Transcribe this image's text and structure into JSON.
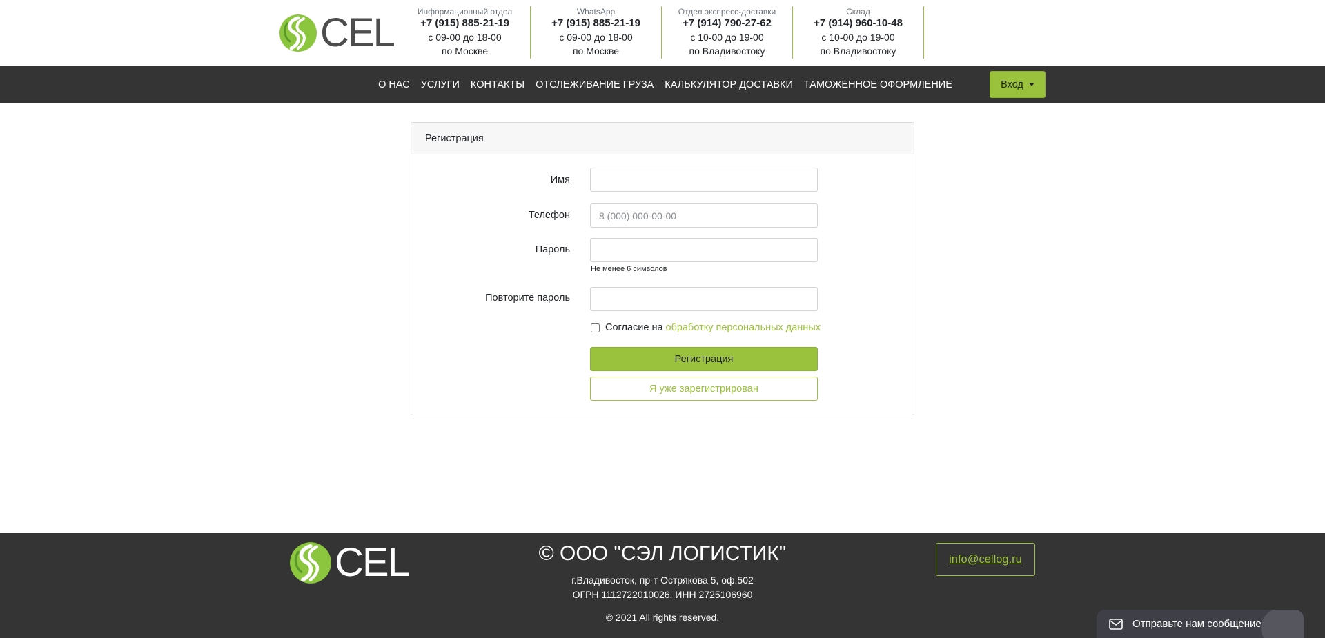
{
  "header": {
    "logo_text": "CEL",
    "contacts": [
      {
        "label": "Информационный отдел",
        "phone": "+7 (915) 885-21-19",
        "hours": "с 09-00 до 18-00",
        "zone": "по Москве"
      },
      {
        "label": "WhatsApp",
        "phone": "+7 (915) 885-21-19",
        "hours": "с 09-00 до 18-00",
        "zone": "по Москве"
      },
      {
        "label": "Отдел экспресс-доставки",
        "phone": "+7 (914) 790-27-62",
        "hours": "с 10-00 до 19-00",
        "zone": "по Владивостоку"
      },
      {
        "label": "Склад",
        "phone": "+7 (914) 960-10-48",
        "hours": "с 10-00 до 19-00",
        "zone": "по Владивостоку"
      }
    ]
  },
  "nav": {
    "items": [
      "О НАС",
      "УСЛУГИ",
      "КОНТАКТЫ",
      "ОТСЛЕЖИВАНИЕ ГРУЗА",
      "КАЛЬКУЛЯТОР ДОСТАВКИ",
      "ТАМОЖЕННОЕ ОФОРМЛЕНИЕ"
    ],
    "login_label": "Вход"
  },
  "form": {
    "title": "Регистрация",
    "name_label": "Имя",
    "name_value": "",
    "phone_label": "Телефон",
    "phone_placeholder": "8 (000) 000-00-00",
    "password_label": "Пароль",
    "password_hint": "Не менее 6 символов",
    "repeat_label": "Повторите пароль",
    "consent_text": "Согласие на",
    "consent_link": "обработку персональных данных",
    "consent_checked": false,
    "submit_label": "Регистрация",
    "already_label": "Я уже зарегистрирован"
  },
  "footer": {
    "logo_text": "CEL",
    "company": "© ООО \"СЭЛ ЛОГИСТИК\"",
    "address": "г.Владивосток, пр-т Острякова 5, оф.502",
    "registration": "ОГРН 1112722010026, ИНН 2725106960",
    "rights": "© 2021 All rights reserved.",
    "email": "info@cellog.ru"
  },
  "chat": {
    "label": "Отправьте нам сообщение",
    "icon": "mail-icon"
  },
  "colors": {
    "accent": "#9bc23c",
    "dark": "#343434",
    "chat_bg": "#3e3f47"
  }
}
